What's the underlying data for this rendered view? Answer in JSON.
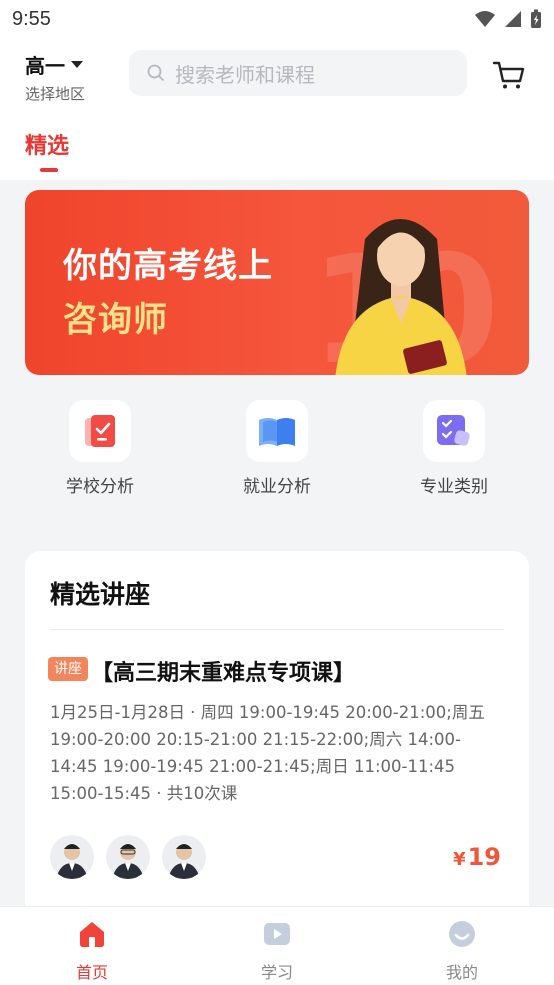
{
  "status_bar": {
    "time": "9:55"
  },
  "header": {
    "grade": "高一",
    "region": "选择地区",
    "search_placeholder": "搜索老师和课程"
  },
  "tabs": [
    {
      "label": "精选",
      "active": true
    }
  ],
  "banner": {
    "line1": "你的高考线上",
    "line2": "咨询师"
  },
  "quick_links": [
    {
      "label": "学校分析",
      "icon": "school-analysis-icon"
    },
    {
      "label": "就业分析",
      "icon": "employment-analysis-icon"
    },
    {
      "label": "专业类别",
      "icon": "major-category-icon"
    }
  ],
  "lectures": {
    "section_title": "精选讲座",
    "course": {
      "badge": "讲座",
      "title": "【高三期末重难点专项课】",
      "schedule": "1月25日-1月28日 · 周四 19:00-19:45 20:00-21:00;周五 19:00-20:00 20:15-21:00 21:15-22:00;周六 14:00-14:45 19:00-19:45 21:00-21:45;周日 11:00-11:45 15:00-15:45 · 共10次课",
      "price_symbol": "¥",
      "price": "19"
    }
  },
  "bottom_nav": [
    {
      "label": "首页",
      "icon": "home-icon",
      "active": true
    },
    {
      "label": "学习",
      "icon": "study-icon",
      "active": false
    },
    {
      "label": "我的",
      "icon": "profile-icon",
      "active": false
    }
  ],
  "colors": {
    "accent": "#e53935",
    "banner": "#f0442c",
    "price": "#f0563a",
    "badge": "#f2855b"
  }
}
